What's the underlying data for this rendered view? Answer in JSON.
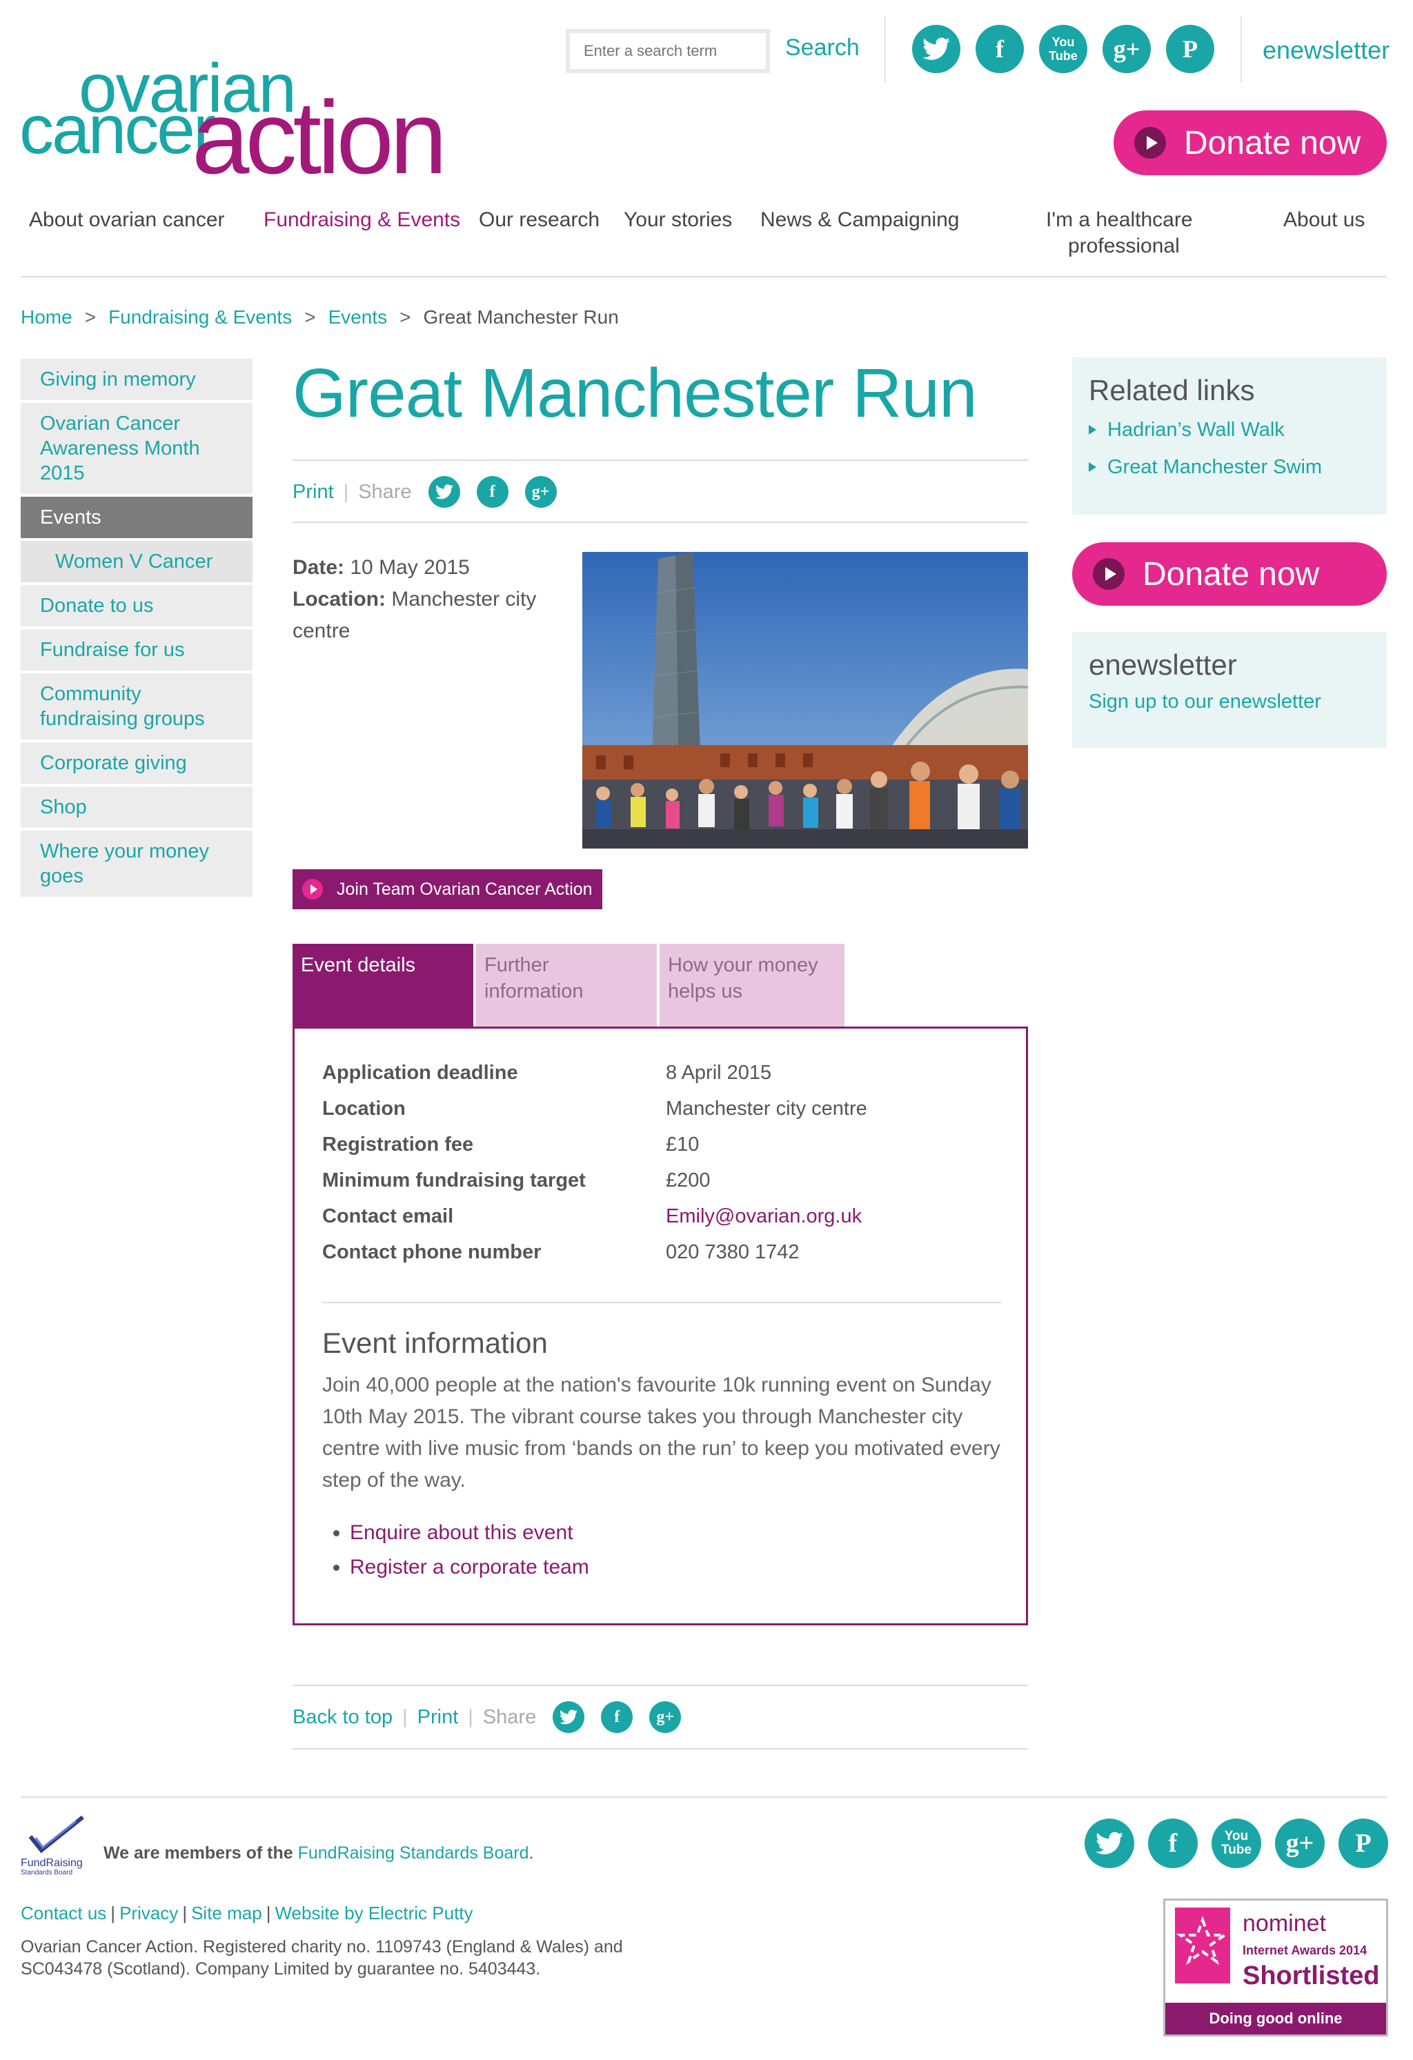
{
  "logo": {
    "line1": "ovarian",
    "line2": "cancer",
    "line3": "action"
  },
  "header": {
    "search_placeholder": "Enter a search term",
    "search_label": "Search",
    "social": {
      "twitter": "t",
      "facebook": "f",
      "youtube_top": "You",
      "youtube_bottom": "Tube",
      "googleplus": "g+",
      "pinterest": "P"
    },
    "enewsletter": "enewsletter",
    "donate": "Donate now"
  },
  "nav": {
    "items": [
      "About ovarian cancer",
      "Fundraising & Events",
      "Our research",
      "Your stories",
      "News & Campaigning",
      "I'm a healthcare",
      "professional",
      "About us"
    ]
  },
  "breadcrumb": {
    "home": "Home",
    "fundraising": "Fundraising & Events",
    "events": "Events",
    "current": "Great Manchester Run",
    "sep": ">"
  },
  "sidebar": {
    "items": [
      "Giving in memory",
      "Ovarian Cancer Awareness Month 2015",
      "Events",
      "Women V Cancer",
      "Donate to us",
      "Fundraise for us",
      "Community fundraising groups",
      "Corporate giving",
      "Shop",
      "Where your money goes"
    ]
  },
  "page": {
    "title": "Great Manchester Run",
    "print": "Print",
    "share": "Share",
    "back_to_top": "Back to top",
    "date_label": "Date:",
    "date_value": "10 May 2015",
    "location_label": "Location:",
    "location_value": "Manchester city centre",
    "join_button": "Join Team Ovarian Cancer Action"
  },
  "tabs": [
    "Event details",
    "Further information",
    "How your money helps us"
  ],
  "details": [
    {
      "k": "Application deadline",
      "v": "8 April 2015"
    },
    {
      "k": "Location",
      "v": "Manchester city centre"
    },
    {
      "k": "Registration fee",
      "v": "£10"
    },
    {
      "k": "Minimum fundraising target",
      "v": "£200"
    },
    {
      "k": "Contact email",
      "v": "Emily@ovarian.org.uk"
    },
    {
      "k": "Contact phone number",
      "v": "020 7380 1742"
    }
  ],
  "event_info": {
    "heading": "Event information",
    "body": "Join 40,000 people at the nation's favourite 10k running event on Sunday 10th May 2015. The vibrant course takes you through Manchester city centre with live music from ‘bands on the run’ to keep you motivated every step of the way.",
    "links": [
      "Enquire about this event",
      "Register a corporate team"
    ]
  },
  "related": {
    "heading": "Related links",
    "links": [
      "Hadrian’s Wall Walk",
      "Great Manchester Swim"
    ]
  },
  "enews_box": {
    "heading": "enewsletter",
    "link": "Sign up to our enewsletter"
  },
  "footer": {
    "frsb_name": "FundRaising",
    "frsb_sub": "Standards Board",
    "members_text": "We are members of the ",
    "members_link": "FundRaising Standards Board",
    "links": [
      "Contact us",
      "Privacy",
      "Site map",
      "Website by Electric Putty"
    ],
    "pipe": "|",
    "copyright": "Ovarian Cancer Action. Registered charity no. 1109743 (England & Wales) and SC043478 (Scotland). Company Limited by guarantee no. 5403443.",
    "nominet": {
      "brand": "nominet",
      "award": "Internet Awards 2014",
      "status": "Shortlisted",
      "tagline": "Doing good online"
    }
  },
  "colors": {
    "teal": "#1aa6a6",
    "plum": "#8b1a6f",
    "pink": "#e5288e"
  }
}
